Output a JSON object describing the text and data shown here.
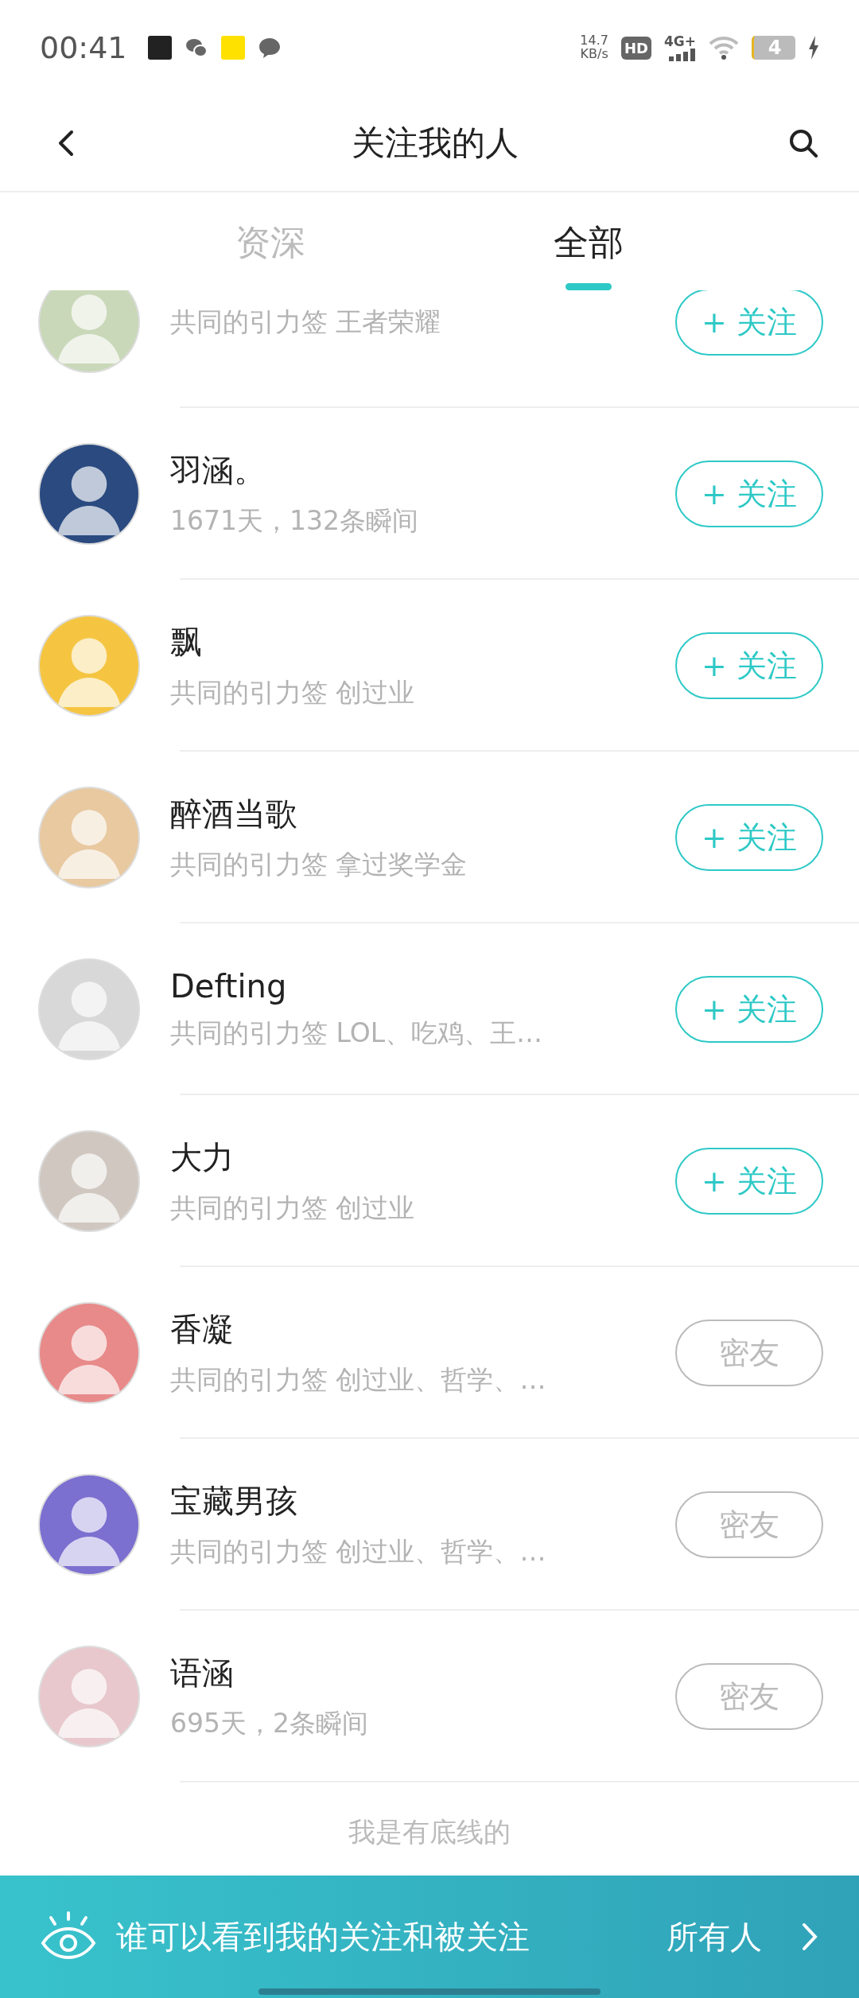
{
  "status_bar": {
    "time": "00:41",
    "speed": "14.7",
    "speed_unit": "KB/s",
    "hd": "HD",
    "network": "4G+",
    "battery": "4"
  },
  "nav": {
    "title": "关注我的人"
  },
  "tabs": [
    {
      "label": "资深",
      "selected": false
    },
    {
      "label": "全部",
      "selected": true
    }
  ],
  "rows": [
    {
      "subtitle": "共同的引力签 王者荣耀",
      "button": {
        "kind": "follow",
        "label": "+ 关注"
      }
    },
    {
      "name": "羽涵。",
      "subtitle": "1671天，132条瞬间",
      "button": {
        "kind": "follow",
        "label": "+ 关注"
      }
    },
    {
      "name": "飘",
      "subtitle": "共同的引力签 创过业",
      "button": {
        "kind": "follow",
        "label": "+ 关注"
      }
    },
    {
      "name": "醉酒当歌",
      "subtitle": "共同的引力签 拿过奖学金",
      "button": {
        "kind": "follow",
        "label": "+ 关注"
      }
    },
    {
      "name": "Defting",
      "subtitle": "共同的引力签 LOL、吃鸡、王…",
      "button": {
        "kind": "follow",
        "label": "+ 关注"
      }
    },
    {
      "name": "大力",
      "subtitle": "共同的引力签 创过业",
      "button": {
        "kind": "follow",
        "label": "+ 关注"
      }
    },
    {
      "name": "香凝",
      "subtitle": "共同的引力签 创过业、哲学、…",
      "button": {
        "kind": "friend",
        "label": "密友"
      }
    },
    {
      "name": "宝藏男孩",
      "subtitle": "共同的引力签 创过业、哲学、…",
      "button": {
        "kind": "friend",
        "label": "密友"
      }
    },
    {
      "name": "语涵",
      "subtitle": "695天，2条瞬间",
      "button": {
        "kind": "friend",
        "label": "密友"
      }
    }
  ],
  "footer_text": "我是有底线的",
  "privacy_bar": {
    "label": "谁可以看到我的关注和被关注",
    "value": "所有人"
  }
}
